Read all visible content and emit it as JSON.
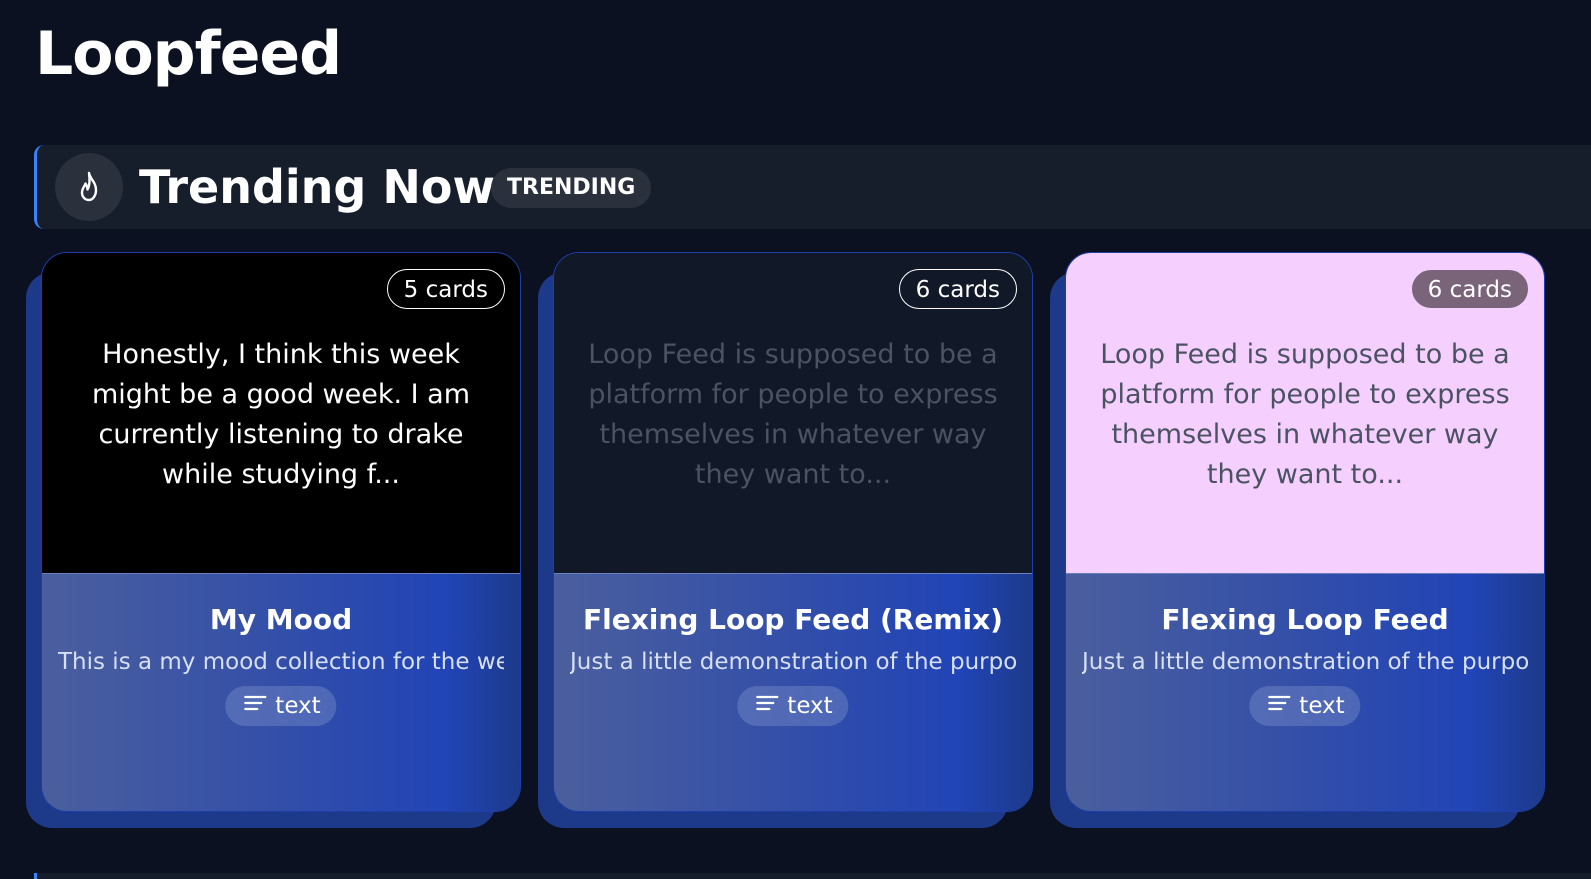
{
  "app": {
    "title": "Loopfeed"
  },
  "section": {
    "title": "Trending Now",
    "badge": "TRENDING",
    "icon": "flame-icon",
    "accent_color": "#3b82f6"
  },
  "cards": [
    {
      "count_label": "5 cards",
      "preview_text": "Honestly, I think this week might be a good week. I am currently listening to drake while studying f...",
      "title": "My Mood",
      "description": "This is a my mood collection for the we...",
      "type_label": "text",
      "type_icon": "text-lines-icon",
      "preview_bg": "#000000",
      "preview_text_color": "#ffffff"
    },
    {
      "count_label": "6 cards",
      "preview_text": "Loop Feed is supposed to be a platform for people to express themselves in whatever way they want to...",
      "title": "Flexing Loop Feed (Remix)",
      "description": "Just a little demonstration of the purpo...",
      "type_label": "text",
      "type_icon": "text-lines-icon",
      "preview_bg": "#111827",
      "preview_text_color": "#4b5363"
    },
    {
      "count_label": "6 cards",
      "preview_text": "Loop Feed is supposed to be a platform for people to express themselves in whatever way they want to...",
      "title": "Flexing Loop Feed",
      "description": "Just a little demonstration of the purpo...",
      "type_label": "text",
      "type_icon": "text-lines-icon",
      "preview_bg": "#f5d0fe",
      "preview_text_color": "#4b5363"
    }
  ]
}
